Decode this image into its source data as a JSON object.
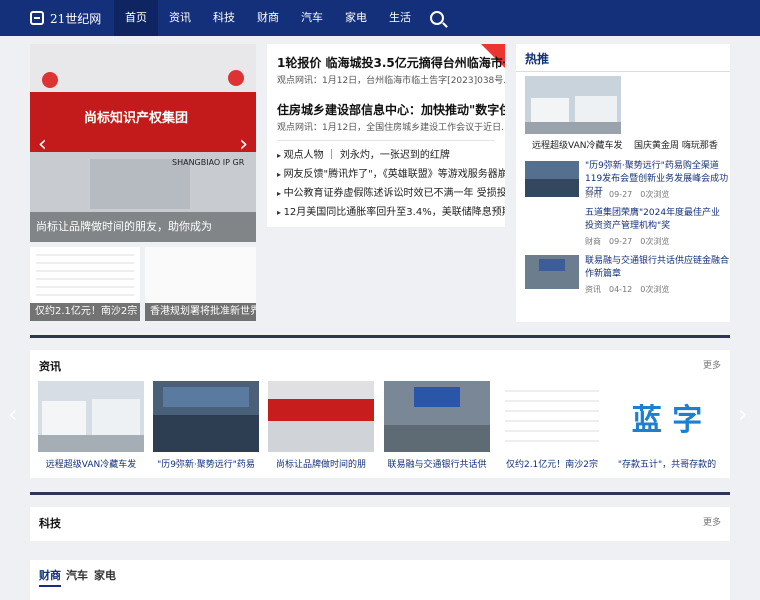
{
  "nav": {
    "logo": "21世纪网",
    "items": [
      "首页",
      "资讯",
      "科技",
      "财商",
      "汽车",
      "家电",
      "生活"
    ],
    "active_index": 0
  },
  "hero": {
    "caption": "尚标让品牌做时间的朋友，助你成为",
    "brand_text": "尚标知识产权集团",
    "brand_sub": "SHANGBIAO IP GR"
  },
  "thumbs": [
    {
      "caption": "仅约2.1亿元！南沙2宗"
    },
    {
      "caption": "香港规划署将批准新世界"
    }
  ],
  "headlines": [
    {
      "title": "1轮报价 临海城投3.5亿元摘得台州临海市一",
      "summary": "观点网讯：1月12日，台州临海市临土告字[2023]038号..."
    },
    {
      "title": "住房城乡建设部信息中心：加快推动\"数字住",
      "summary": "观点网讯：1月12日，全国住房城乡建设工作会议于近日..."
    }
  ],
  "news_list": [
    "观点人物 ｜ 刘永灼，一张迟到的红牌",
    "网友反馈\"腾讯炸了\"，《英雄联盟》等游戏服务器崩溃",
    "中公教育证券虚假陈述诉讼时效已不满一年 受损投...",
    "12月美国同比通胀率回升至3.4%，美联储降息预期..."
  ],
  "hot": {
    "title": "热推",
    "top": [
      {
        "title": "远程超级VAN冷藏车发"
      },
      {
        "title": "国庆黄金周 嗨玩那香"
      }
    ],
    "items": [
      {
        "title": "\"历9弥新·聚势远行\"药易购全渠道119发布会暨创新业务发展峰会成功召开",
        "category": "资讯",
        "date": "09-27",
        "views": "0次浏览"
      },
      {
        "title": "五道集团荣膺\"2024年度最佳产业投资资产管理机构\"奖",
        "category": "财商",
        "date": "09-27",
        "views": "0次浏览"
      },
      {
        "title": "联易融与交通银行共话供应链金融合作新篇章",
        "category": "资讯",
        "date": "04-12",
        "views": "0次浏览"
      }
    ]
  },
  "zixun": {
    "title": "资讯",
    "more": "更多",
    "cards": [
      "远程超级VAN冷藏车发",
      "\"历9弥新·聚势远行\"药易",
      "尚标让品牌做时间的朋",
      "联易融与交通银行共话供",
      "仅约2.1亿元！南沙2宗",
      "\"存款五计\"，共哥存款的"
    ],
    "card5_text": "蓝 字"
  },
  "keji": {
    "title": "科技",
    "more": "更多"
  },
  "bottom_tabs": [
    "财商",
    "汽车",
    "家电"
  ],
  "colors": {
    "nav": "#14307a",
    "accent": "#14307a",
    "divider": "#2f3555"
  }
}
